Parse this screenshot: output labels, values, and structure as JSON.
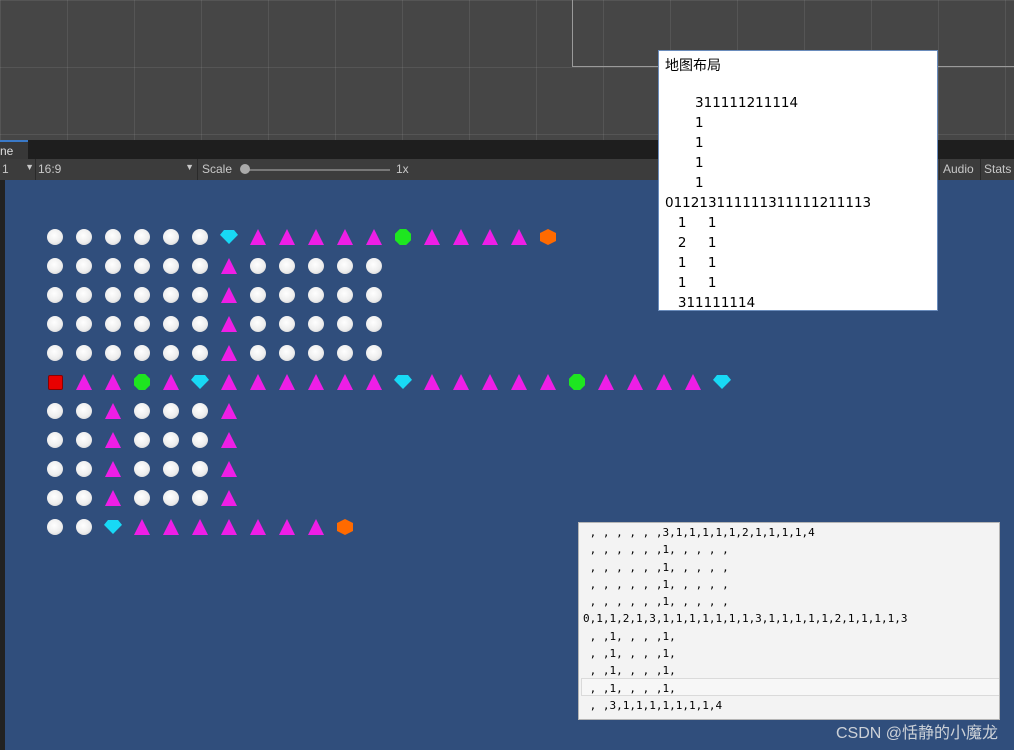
{
  "toolbar": {
    "tab_label": "ne",
    "display_value": "1",
    "aspect_value": "16:9",
    "scale_label": "Scale",
    "scale_value": "1x",
    "scale_level": 0.0,
    "audio_label": "Audio",
    "stats_label": "Stats"
  },
  "map_panel": {
    "title": "地图布局",
    "lines": [
      "       311111211114",
      "       1",
      "       1",
      "       1",
      "       1",
      "011213111111311111211113",
      "   1     1",
      "   2     1",
      "   1     1",
      "   1     1",
      "   311111114"
    ]
  },
  "array_panel": {
    "lines": [
      " , , , , , ,3,1,1,1,1,1,2,1,1,1,1,4",
      " , , , , , ,1, , , , ,",
      " , , , , , ,1, , , , ,",
      " , , , , , ,1, , , , ,",
      " , , , , , ,1, , , , ,",
      "0,1,1,2,1,3,1,1,1,1,1,1,1,3,1,1,1,1,1,2,1,1,1,1,3",
      " , ,1, , , ,1,",
      " , ,1, , , ,1,",
      " , ,1, , , ,1,",
      " , ,1, , , ,1,",
      " , ,3,1,1,1,1,1,1,1,4"
    ]
  },
  "board": {
    "legend": {
      "0": "red-square",
      "C": "white-circle",
      "T": "magenta-triangle",
      "D": "cyan-gem",
      "G": "green-octagon",
      "O": "orange-hexagon"
    },
    "rows": [
      "CCCCCCDTTTTTGTTTTO",
      "CCCCCCTCCCCC",
      "CCCCCCTCCCCC",
      "CCCCCCTCCCCC",
      "CCCCCCTCCCCC",
      "0TTGTDTTTTTTDTTTTTGTTTTD",
      "CCTCCCT",
      "CCTCCCT",
      "CCTCCCT",
      "CCTCCCT",
      "CCDTTTTTTTO"
    ]
  },
  "watermark": "CSDN @恬静的小魔龙"
}
